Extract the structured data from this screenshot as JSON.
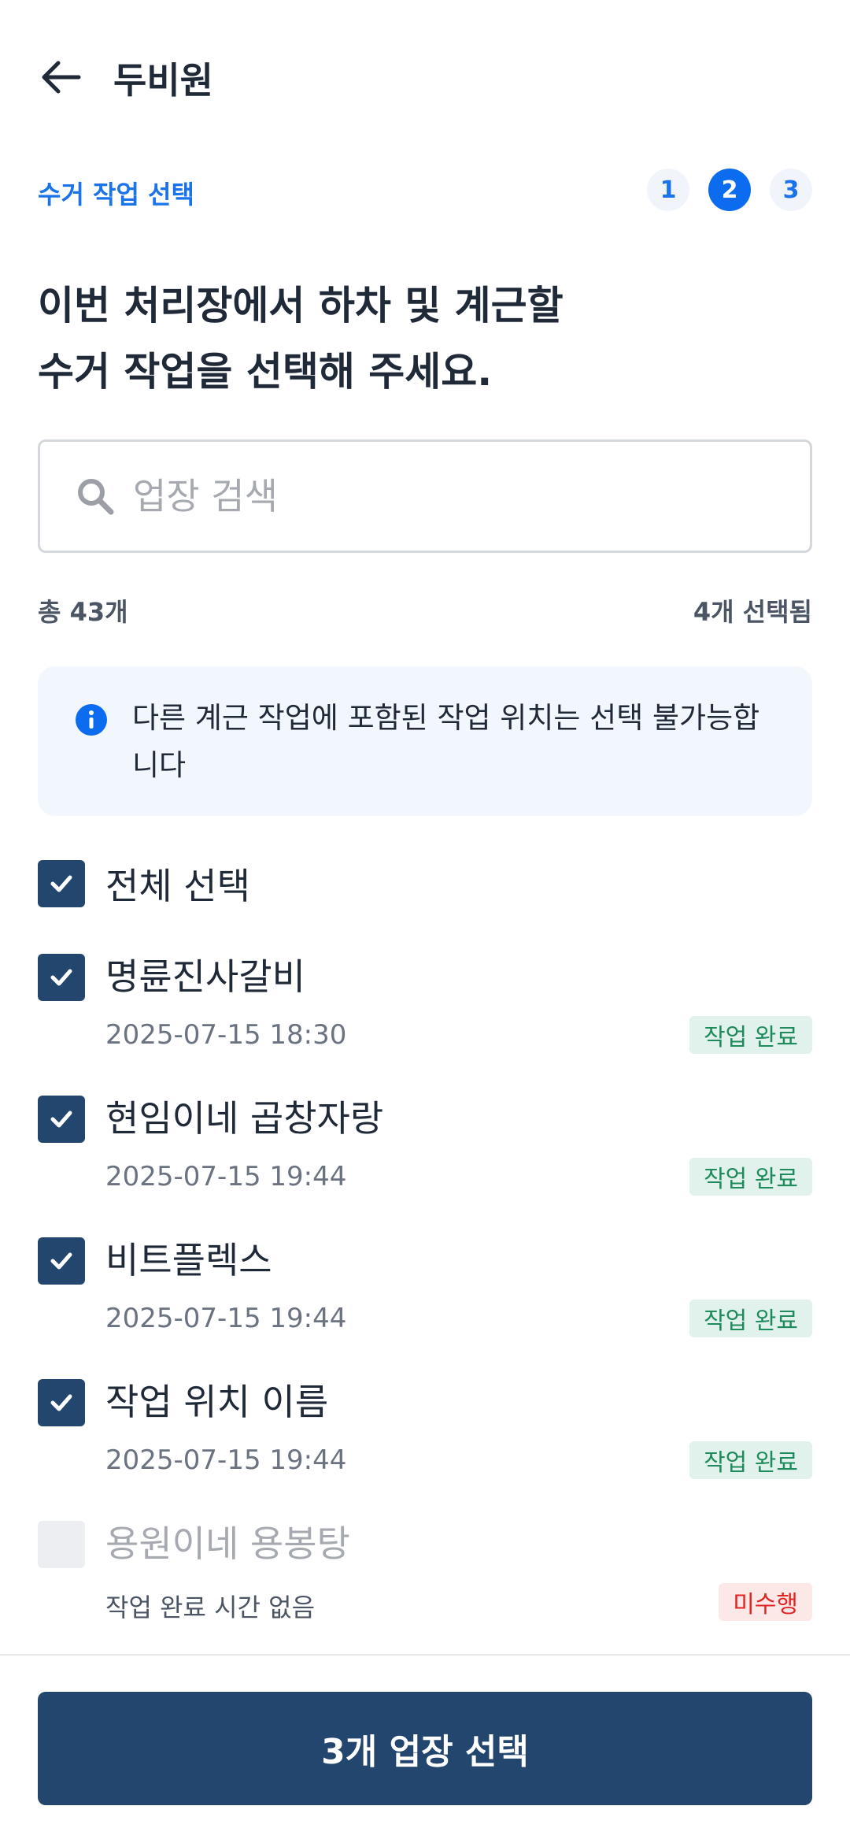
{
  "header": {
    "title": "두비원",
    "back_icon": "arrow-left-icon"
  },
  "stepper": {
    "label": "수거 작업 선택",
    "steps": [
      {
        "number": "1",
        "active": false
      },
      {
        "number": "2",
        "active": true
      },
      {
        "number": "3",
        "active": false
      }
    ]
  },
  "headline": [
    "이번 처리장에서 하차 및 계근할",
    "수거 작업을 선택해 주세요."
  ],
  "search": {
    "placeholder": "업장 검색",
    "value": "",
    "icon": "search-icon"
  },
  "counts": {
    "total": "총 43개",
    "selected": "4개 선택됨"
  },
  "notice": {
    "icon": "info-icon",
    "text": "다른 계근 작업에 포함된 작업 위치는 선택 불가능합니다"
  },
  "select_all": {
    "label": "전체 선택",
    "checked": true
  },
  "items": [
    {
      "name": "명륜진사갈비",
      "time": "2025-07-15 18:30",
      "status": "작업 완료",
      "checked": true,
      "disabled": false
    },
    {
      "name": "현임이네 곱창자랑",
      "time": "2025-07-15 19:44",
      "status": "작업 완료",
      "checked": true,
      "disabled": false
    },
    {
      "name": "비트플렉스",
      "time": "2025-07-15 19:44",
      "status": "작업 완료",
      "checked": true,
      "disabled": false
    },
    {
      "name": "작업 위치 이름",
      "time": "2025-07-15 19:44",
      "status": "작업 완료",
      "checked": true,
      "disabled": false
    },
    {
      "name": "용원이네 용봉탕",
      "time": "작업 완료 시간 없음",
      "status": "미수행",
      "checked": false,
      "disabled": true
    }
  ],
  "cta": {
    "label": "3개 업장 선택"
  },
  "colors": {
    "primary": "#23466f",
    "accent": "#0b6cf0",
    "done_bg": "#e0f2eb",
    "done_text": "#1f8a5b",
    "todo_bg": "#fde8e8",
    "todo_text": "#e02424"
  }
}
